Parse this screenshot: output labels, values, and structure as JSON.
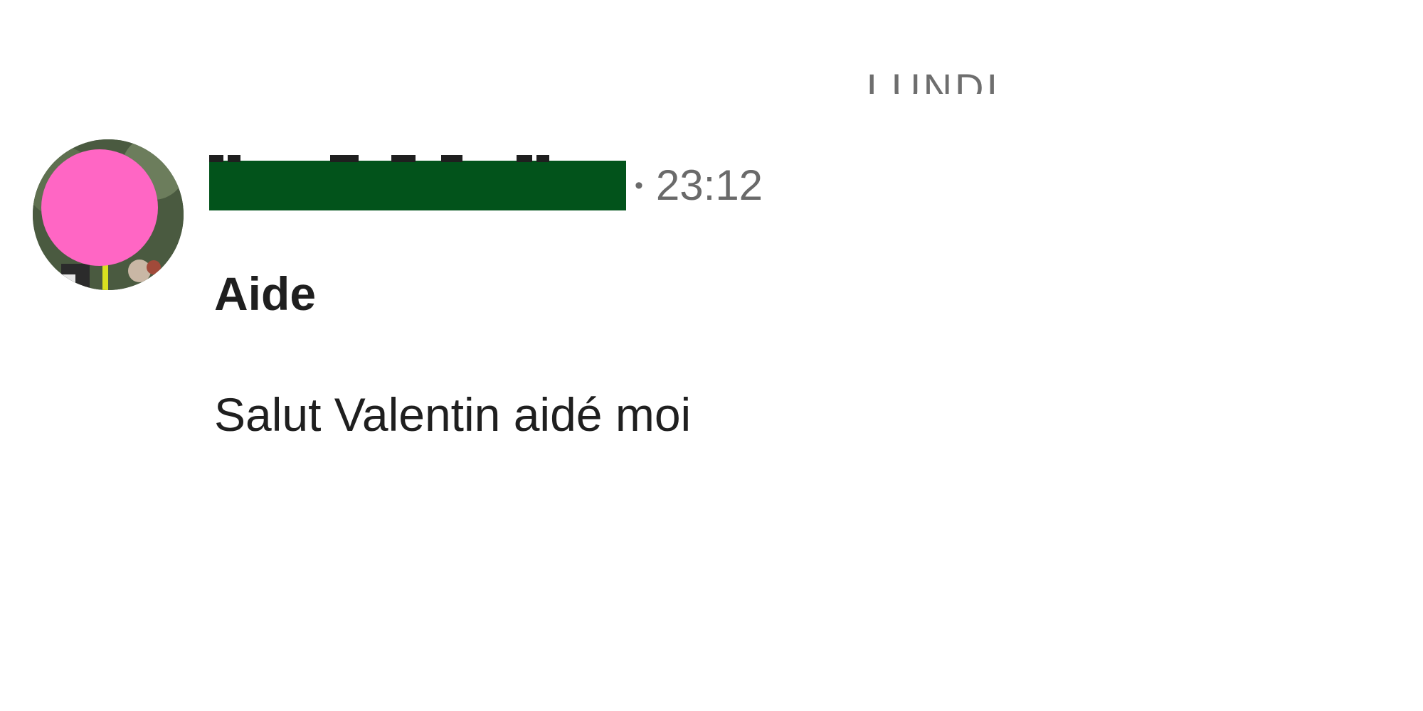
{
  "day_separator": {
    "label": "LUNDI"
  },
  "message": {
    "avatar": {
      "icon": "user-avatar-photo",
      "overlay_color": "#ff66c4"
    },
    "author": {
      "redaction_color": "#02531b"
    },
    "separator": "•",
    "timestamp": "23:12",
    "subject": "Aide",
    "body": "Salut Valentin aidé moi"
  }
}
